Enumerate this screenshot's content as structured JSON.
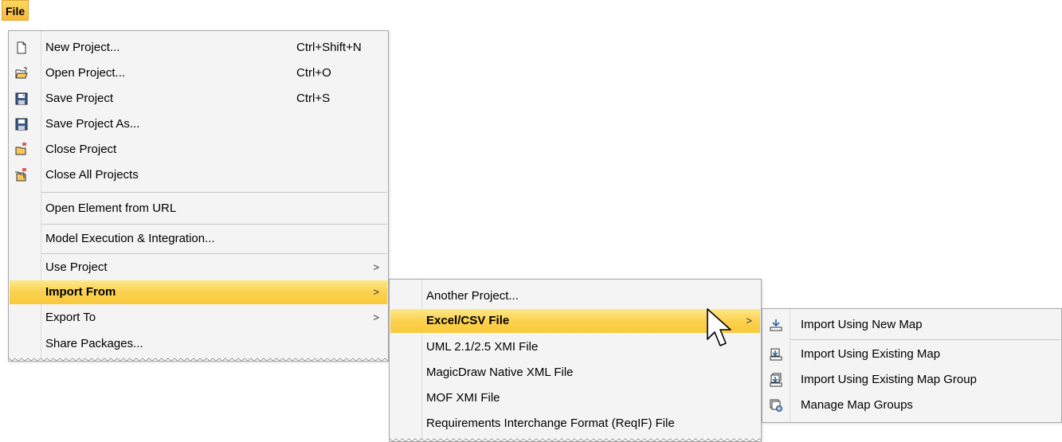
{
  "menubar": {
    "file_label": "File"
  },
  "file_menu": {
    "items": [
      {
        "label": "New Project...",
        "shortcut": "Ctrl+Shift+N",
        "icon": "new-file-icon"
      },
      {
        "label": "Open Project...",
        "shortcut": "Ctrl+O",
        "icon": "open-folder-icon"
      },
      {
        "label": "Save Project",
        "shortcut": "Ctrl+S",
        "icon": "save-icon"
      },
      {
        "label": "Save Project As...",
        "icon": "save-as-icon"
      },
      {
        "label": "Close Project",
        "icon": "close-project-icon"
      },
      {
        "label": "Close All Projects",
        "icon": "close-all-projects-icon"
      },
      {
        "label": "Open Element from URL"
      },
      {
        "label": "Model Execution & Integration..."
      },
      {
        "label": "Use Project",
        "submenu": true
      },
      {
        "label": "Import From",
        "submenu": true,
        "highlighted": true
      },
      {
        "label": "Export To",
        "submenu": true
      },
      {
        "label": "Share Packages..."
      }
    ]
  },
  "import_menu": {
    "items": [
      {
        "label": "Another Project..."
      },
      {
        "label": "Excel/CSV File",
        "submenu": true,
        "highlighted": true
      },
      {
        "label": "UML 2.1/2.5 XMI File"
      },
      {
        "label": "MagicDraw Native XML File"
      },
      {
        "label": "MOF XMI File"
      },
      {
        "label": "Requirements Interchange Format (ReqIF) File"
      }
    ]
  },
  "excel_menu": {
    "items": [
      {
        "label": "Import Using New Map",
        "icon": "import-new-map-icon"
      },
      {
        "label": "Import Using Existing Map",
        "icon": "import-existing-map-icon"
      },
      {
        "label": "Import Using Existing Map Group",
        "icon": "import-map-group-icon"
      },
      {
        "label": "Manage Map Groups",
        "icon": "manage-map-groups-icon"
      }
    ]
  },
  "colors": {
    "highlight": "#fbd14f",
    "menu_bg": "#f4f4f4",
    "border": "#a9a9a9"
  }
}
